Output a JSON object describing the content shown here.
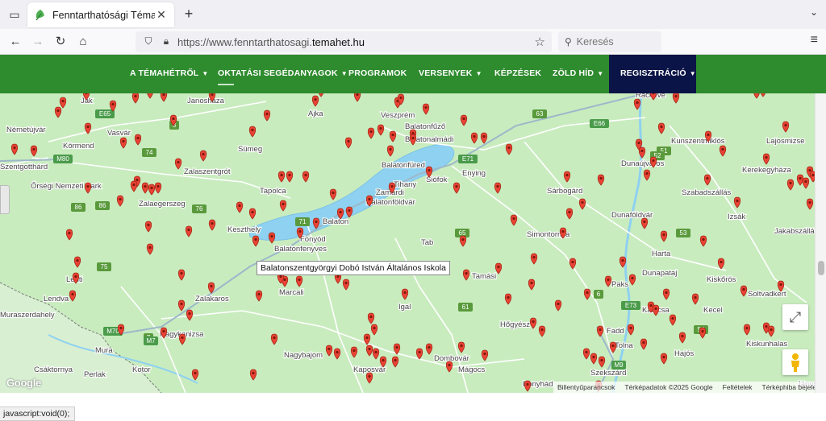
{
  "browser": {
    "tab_title": "Fenntarthatósági Témahét",
    "url_prefix": "https://www.fenntarthatosagi.",
    "url_domain": "temahet.hu",
    "search_placeholder": "Keresés"
  },
  "sitenav": {
    "items": [
      {
        "label": "A TÉMAHÉTRŐL",
        "has_caret": true
      },
      {
        "label": "OKTATÁSI SEGÉDANYAGOK",
        "has_caret": true
      },
      {
        "label": "PROGRAMOK",
        "has_caret": false
      },
      {
        "label": "VERSENYEK",
        "has_caret": true
      },
      {
        "label": "KÉPZÉSEK",
        "has_caret": false
      },
      {
        "label": "ZÖLD HÍD",
        "has_caret": true
      },
      {
        "label": "REGISZTRÁCIÓ",
        "has_caret": true
      }
    ],
    "accent_color": "#2e8b2e",
    "register_color": "#0b1446"
  },
  "map": {
    "tooltip": "Balatonszentgyörgyi Dobó István Általános Iskola",
    "labels": [
      "Ják",
      "Janoshaza",
      "Ajka",
      "Veszprém",
      "Ráckeve",
      "Németújvár",
      "Vasvár",
      "Balatonfűző",
      "Balatonalmádi",
      "Kunszentmiklós",
      "Lajosmizse",
      "Körmend",
      "Sümeg",
      "Dunaújváros",
      "Kerekegyháza",
      "Szentgotthárd",
      "Zalaszentgrót",
      "Balatonfüred",
      "Enying",
      "Tapolca",
      "Siófok",
      "Sárbogárd",
      "Szabadszállás",
      "Őrségi Nemzeti Park",
      "Zalaegerszeg",
      "Tihany",
      "Zamárdi",
      "Izsák",
      "Balatonföldvár",
      "Dunaföldvár",
      "Keszthely",
      "Balaton",
      "Fonyód",
      "Simontornya",
      "Jakabszállás",
      "Balatonfenyves",
      "Tab",
      "Harta",
      "Lenti",
      "Dunapataj",
      "Tamási",
      "Paks",
      "Kiskőrös",
      "Marcali",
      "Lendva",
      "Zalakaros",
      "Igal",
      "Soltvadkert",
      "Kecel",
      "Muraszerdahely",
      "Kalocsa",
      "Hőgyész",
      "Nagykanizsa",
      "Fadd",
      "Kiskunhalas",
      "Mura",
      "Tolna",
      "Hajós",
      "Csáktornya",
      "Nagybajom",
      "Dombovár",
      "Kaposvár",
      "Szekszárd",
      "Perlak",
      "Kotor",
      "Mágocs",
      "Bonyhád",
      "Jánoshalma"
    ],
    "road_labels": [
      "E65",
      "86",
      "8",
      "74",
      "M80",
      "76",
      "75",
      "86",
      "71",
      "7",
      "M7",
      "E71",
      "E66",
      "63",
      "65",
      "61",
      "6",
      "E73",
      "51",
      "52",
      "53",
      "54",
      "M9",
      "M70"
    ],
    "google_logo": "Google",
    "attribution": [
      "Billentyűparancsok",
      "Térképadatok ©2025 Google",
      "Feltételek",
      "Térképhiba bejelentése"
    ]
  },
  "status_text": "javascript:void(0);"
}
